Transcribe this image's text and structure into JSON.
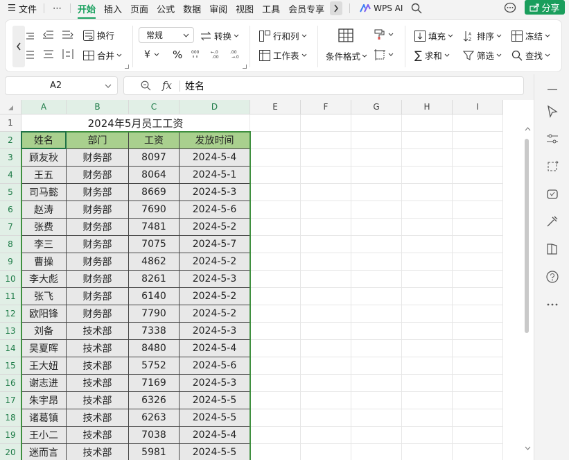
{
  "menu": {
    "file_icon": "hamburger-icon",
    "file": "文件",
    "more": "⋯",
    "tabs": [
      "开始",
      "插入",
      "页面",
      "公式",
      "数据",
      "审阅",
      "视图",
      "工具",
      "会员专享"
    ],
    "active_tab": "开始",
    "wps_ai": "WPS AI",
    "share": "分享"
  },
  "ribbon": {
    "wrap": "换行",
    "merge": "合并",
    "format_combo": "常规",
    "convert": "转换",
    "rowcol": "行和列",
    "worksheet": "工作表",
    "cond_format": "条件格式",
    "fill": "填充",
    "sort": "排序",
    "freeze": "冻结",
    "sum": "求和",
    "filter": "筛选",
    "find": "查找",
    "yen": "¥",
    "percent": "%"
  },
  "formula_bar": {
    "name_box": "A2",
    "fx": "fx",
    "content": "姓名"
  },
  "columns": [
    "A",
    "B",
    "C",
    "D",
    "E",
    "F",
    "G",
    "H",
    "I"
  ],
  "rows": [
    "1",
    "2",
    "3",
    "4",
    "5",
    "6",
    "7",
    "8",
    "9",
    "10",
    "11",
    "12",
    "13",
    "14",
    "15",
    "16",
    "17",
    "18",
    "19",
    "20"
  ],
  "sheet": {
    "title": "2024年5月员工工资",
    "headers": [
      "姓名",
      "部门",
      "工资",
      "发放时间"
    ],
    "data": [
      [
        "顾友秋",
        "财务部",
        "8097",
        "2024-5-4"
      ],
      [
        "王五",
        "财务部",
        "8064",
        "2024-5-1"
      ],
      [
        "司马懿",
        "财务部",
        "8669",
        "2024-5-3"
      ],
      [
        "赵涛",
        "财务部",
        "7690",
        "2024-5-6"
      ],
      [
        "张费",
        "财务部",
        "7481",
        "2024-5-2"
      ],
      [
        "李三",
        "财务部",
        "7075",
        "2024-5-7"
      ],
      [
        "曹操",
        "财务部",
        "4862",
        "2024-5-2"
      ],
      [
        "李大彪",
        "财务部",
        "8261",
        "2024-5-3"
      ],
      [
        "张飞",
        "财务部",
        "6140",
        "2024-5-2"
      ],
      [
        "欧阳锋",
        "财务部",
        "7790",
        "2024-5-2"
      ],
      [
        "刘备",
        "技术部",
        "7338",
        "2024-5-3"
      ],
      [
        "吴夏晖",
        "技术部",
        "8480",
        "2024-5-4"
      ],
      [
        "王大妞",
        "技术部",
        "5752",
        "2024-5-6"
      ],
      [
        "谢志进",
        "技术部",
        "7169",
        "2024-5-3"
      ],
      [
        "朱宇昂",
        "技术部",
        "6326",
        "2024-5-5"
      ],
      [
        "诸葛镇",
        "技术部",
        "6263",
        "2024-5-5"
      ],
      [
        "王小二",
        "技术部",
        "7038",
        "2024-5-4"
      ],
      [
        "迷而言",
        "技术部",
        "5981",
        "2024-5-5"
      ]
    ]
  },
  "colors": {
    "accent": "#17a05d",
    "header_fill": "#a9d08e",
    "body_fill": "#e8e8e8",
    "table_border": "#3f8f3f"
  }
}
